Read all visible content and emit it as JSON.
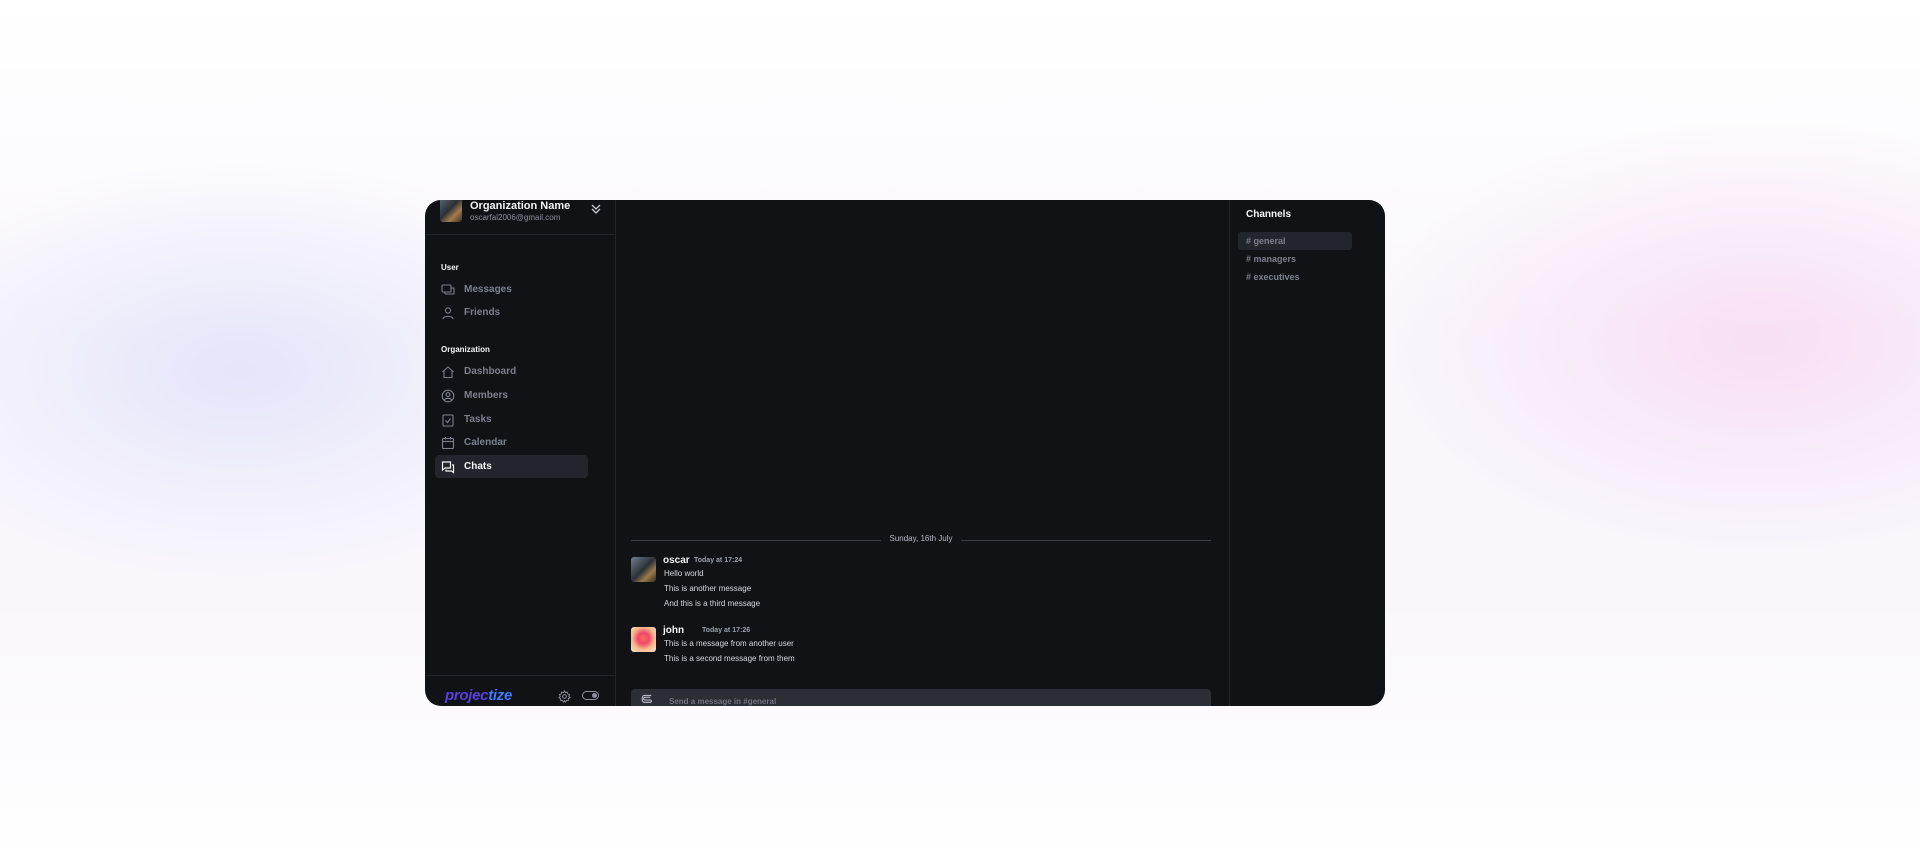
{
  "org": {
    "name": "Organization Name",
    "email": "oscarfal2006@gmail.com"
  },
  "sidebar": {
    "user_section_label": "User",
    "user_items": [
      {
        "label": "Messages",
        "icon": "messages-icon"
      },
      {
        "label": "Friends",
        "icon": "user-icon"
      }
    ],
    "org_section_label": "Organization",
    "org_items": [
      {
        "label": "Dashboard",
        "icon": "home-icon"
      },
      {
        "label": "Members",
        "icon": "user-circle-icon"
      },
      {
        "label": "Tasks",
        "icon": "clipboard-check-icon"
      },
      {
        "label": "Calendar",
        "icon": "calendar-icon"
      },
      {
        "label": "Chats",
        "icon": "chats-icon",
        "active": true
      }
    ],
    "logo_a": "projec",
    "logo_b": "tize"
  },
  "chat": {
    "date_separator": "Sunday, 16th July",
    "messages": [
      {
        "author": "oscar",
        "time": "Today at 17:24",
        "lines": [
          "Hello world",
          "This is another message",
          "And this is a third message"
        ]
      },
      {
        "author": "john",
        "time": "Today at 17:26",
        "lines": [
          "This is a message from another user",
          "This is a second message from them"
        ]
      }
    ],
    "composer_placeholder": "Send a message in #general"
  },
  "channels": {
    "title": "Channels",
    "items": [
      {
        "label": "# general",
        "active": true
      },
      {
        "label": "# managers"
      },
      {
        "label": "# executives"
      }
    ]
  },
  "colors": {
    "app_bg": "#111216",
    "active_bg": "#23252c",
    "muted_text": "#7b808c",
    "logo_purple": "#5b3ee0",
    "logo_blue": "#3d7bff"
  }
}
